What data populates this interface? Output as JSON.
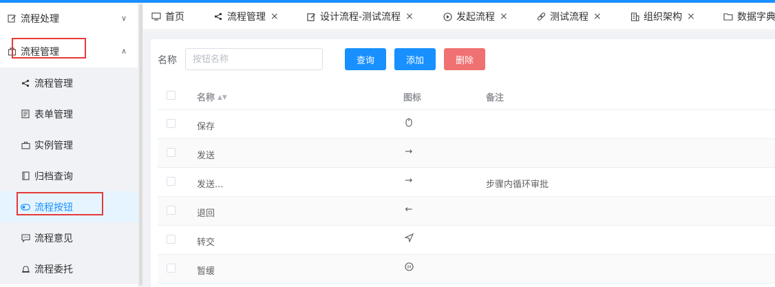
{
  "sidebar": {
    "groups": [
      {
        "label": "流程处理",
        "chevron": "∨",
        "icon": "edit-icon"
      },
      {
        "label": "流程管理",
        "chevron": "∧",
        "icon": "bag-icon"
      }
    ],
    "items": [
      {
        "label": "流程管理",
        "icon": "share-icon"
      },
      {
        "label": "表单管理",
        "icon": "form-icon"
      },
      {
        "label": "实例管理",
        "icon": "briefcase-icon"
      },
      {
        "label": "归档查询",
        "icon": "archive-icon"
      },
      {
        "label": "流程按钮",
        "icon": "toggle-icon",
        "active": true
      },
      {
        "label": "流程意见",
        "icon": "comment-icon"
      },
      {
        "label": "流程委托",
        "icon": "bell-icon"
      }
    ]
  },
  "tabs": [
    {
      "label": "首页",
      "icon": "monitor-icon",
      "closable": false
    },
    {
      "label": "流程管理",
      "icon": "share-icon",
      "closable": true
    },
    {
      "label": "设计流程-测试流程",
      "icon": "edit-icon",
      "closable": true
    },
    {
      "label": "发起流程",
      "icon": "play-icon",
      "closable": true
    },
    {
      "label": "测试流程",
      "icon": "link-icon",
      "closable": true
    },
    {
      "label": "组织架构",
      "icon": "building-icon",
      "closable": true
    },
    {
      "label": "数据字典",
      "icon": "folder-icon",
      "closable": false
    }
  ],
  "tab_close_glyph": "×",
  "query": {
    "label": "名称",
    "placeholder": "按钮名称",
    "value": "",
    "search_label": "查询",
    "add_label": "添加",
    "delete_label": "删除"
  },
  "table": {
    "columns": [
      "名称",
      "图标",
      "备注"
    ],
    "sort_glyph": "▲▼",
    "rows": [
      {
        "name": "保存",
        "icon": "mouse-icon",
        "glyph": "🖱",
        "note": ""
      },
      {
        "name": "发送",
        "icon": "arrow-right-icon",
        "glyph": "→",
        "note": ""
      },
      {
        "name": "发送...",
        "icon": "arrow-right-icon",
        "glyph": "→",
        "note": "步骤内循环审批"
      },
      {
        "name": "退回",
        "icon": "arrow-left-icon",
        "glyph": "←",
        "note": ""
      },
      {
        "name": "转交",
        "icon": "send-icon",
        "glyph": "➤",
        "note": ""
      },
      {
        "name": "暂缓",
        "icon": "pause-icon",
        "glyph": "⏸",
        "note": ""
      }
    ]
  },
  "colors": {
    "accent": "#1890ff",
    "danger": "#f07171",
    "highlight": "#e53935"
  }
}
